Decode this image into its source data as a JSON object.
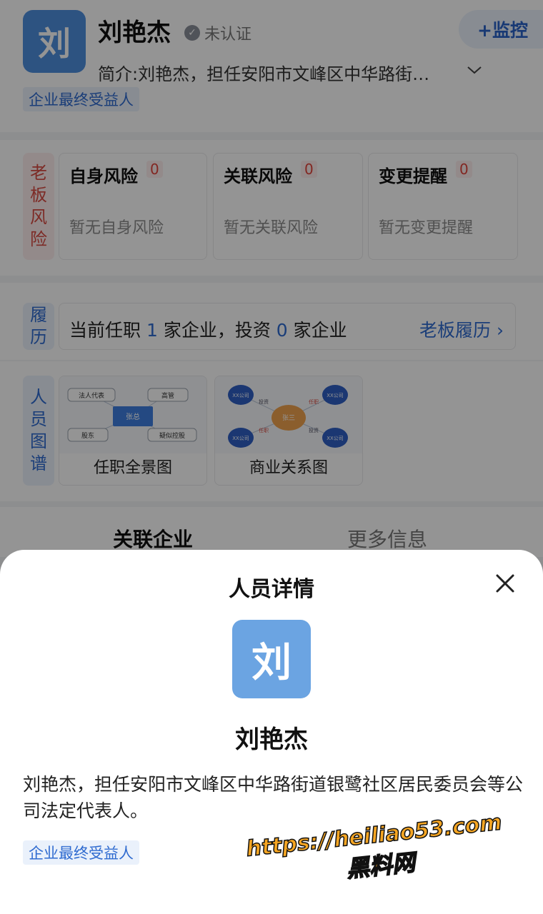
{
  "header": {
    "avatar_char": "刘",
    "name": "刘艳杰",
    "verify_text": "未认证",
    "monitor_label": "+监控",
    "intro": "简介:刘艳杰，担任安阳市文峰区中华路街…",
    "tag": "企业最终受益人"
  },
  "boss_risk": {
    "side_label": [
      "老",
      "板",
      "风",
      "险"
    ],
    "cards": [
      {
        "title": "自身风险",
        "count": "0",
        "empty": "暂无自身风险"
      },
      {
        "title": "关联风险",
        "count": "0",
        "empty": "暂无关联风险"
      },
      {
        "title": "变更提醒",
        "count": "0",
        "empty": "暂无变更提醒"
      }
    ]
  },
  "history": {
    "side_label": [
      "履",
      "历"
    ],
    "text_1": "当前任职",
    "num_1": "1",
    "text_2": "家企业，投资",
    "num_2": "0",
    "text_3": "家企业",
    "link": "老板履历"
  },
  "graph": {
    "side_label": [
      "人",
      "员",
      "图",
      "谱"
    ],
    "cards": [
      {
        "label": "任职全景图",
        "center": "张总",
        "nodes": [
          "法人代表",
          "高管",
          "股东",
          "疑似控股"
        ]
      },
      {
        "label": "商业关系图",
        "center": "张三",
        "nodes": [
          "XX公司",
          "XX公司",
          "XX公司",
          "XX公司"
        ],
        "edges": [
          "投资",
          "任职",
          "任职",
          "投资"
        ]
      }
    ]
  },
  "tabs": [
    "关联企业",
    "更多信息"
  ],
  "sheet": {
    "title": "人员详情",
    "avatar_char": "刘",
    "name": "刘艳杰",
    "description": "刘艳杰，担任安阳市文峰区中华路街道银鹭社区居民委员会等公司法定代表人。",
    "tag": "企业最终受益人"
  },
  "watermark": {
    "line1": "https://heiliao53.com",
    "line2": "黑料网"
  }
}
